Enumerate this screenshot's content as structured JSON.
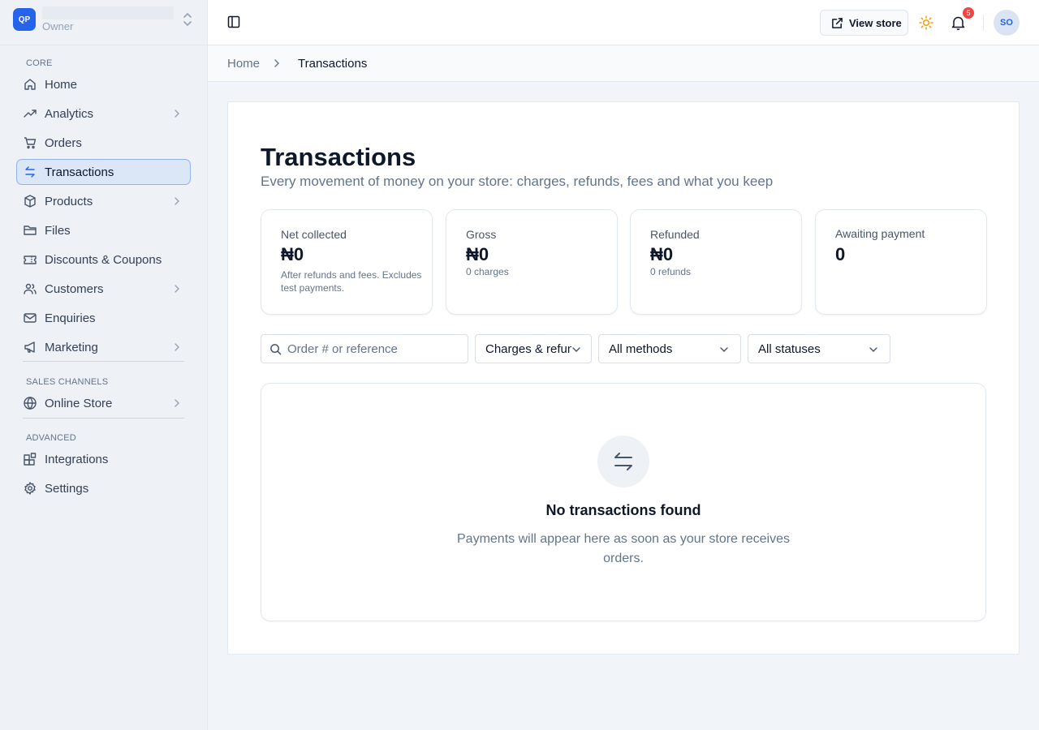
{
  "store": {
    "logo": "QP",
    "role": "Owner"
  },
  "sidebar": {
    "sections": {
      "core": "CORE",
      "sales_channels": "SALES CHANNELS",
      "advanced": "ADVANCED"
    },
    "items": [
      {
        "label": "Home",
        "icon": "home-icon"
      },
      {
        "label": "Analytics",
        "icon": "trending-icon"
      },
      {
        "label": "Orders",
        "icon": "cart-icon"
      },
      {
        "label": "Transactions",
        "icon": "arrows-swap-icon",
        "active": true
      },
      {
        "label": "Products",
        "icon": "box-icon"
      },
      {
        "label": "Files",
        "icon": "folder-icon"
      },
      {
        "label": "Discounts & Coupons",
        "icon": "ticket-icon"
      },
      {
        "label": "Customers",
        "icon": "users-icon"
      },
      {
        "label": "Enquiries",
        "icon": "mail-icon"
      },
      {
        "label": "Marketing",
        "icon": "megaphone-icon"
      },
      {
        "label": "Online Store",
        "icon": "globe-icon"
      },
      {
        "label": "Integrations",
        "icon": "blocks-icon"
      },
      {
        "label": "Settings",
        "icon": "gear-icon"
      }
    ]
  },
  "topbar": {
    "view_store_label": "View store",
    "notification_count": "5",
    "avatar_initials": "SO"
  },
  "breadcrumb": {
    "home": "Home",
    "current": "Transactions"
  },
  "page": {
    "title": "Transactions",
    "subtitle": "Every movement of money on your store: charges, refunds, fees and what you keep"
  },
  "stats": [
    {
      "label": "Net collected",
      "value": "₦0",
      "note": "After refunds and fees. Excludes test payments."
    },
    {
      "label": "Gross",
      "value": "₦0",
      "note": "0 charges"
    },
    {
      "label": "Refunded",
      "value": "₦0",
      "note": "0 refunds"
    },
    {
      "label": "Awaiting payment",
      "value": "0",
      "note": ""
    }
  ],
  "filters": {
    "search_placeholder": "Order # or reference",
    "type": "Charges & refunds",
    "method": "All methods",
    "status": "All statuses"
  },
  "empty_state": {
    "title": "No transactions found",
    "text": "Payments will appear here as soon as your store receives orders."
  },
  "colors": {
    "accent": "#2563eb",
    "badge": "#ef4444",
    "sun": "#f59e0b"
  }
}
